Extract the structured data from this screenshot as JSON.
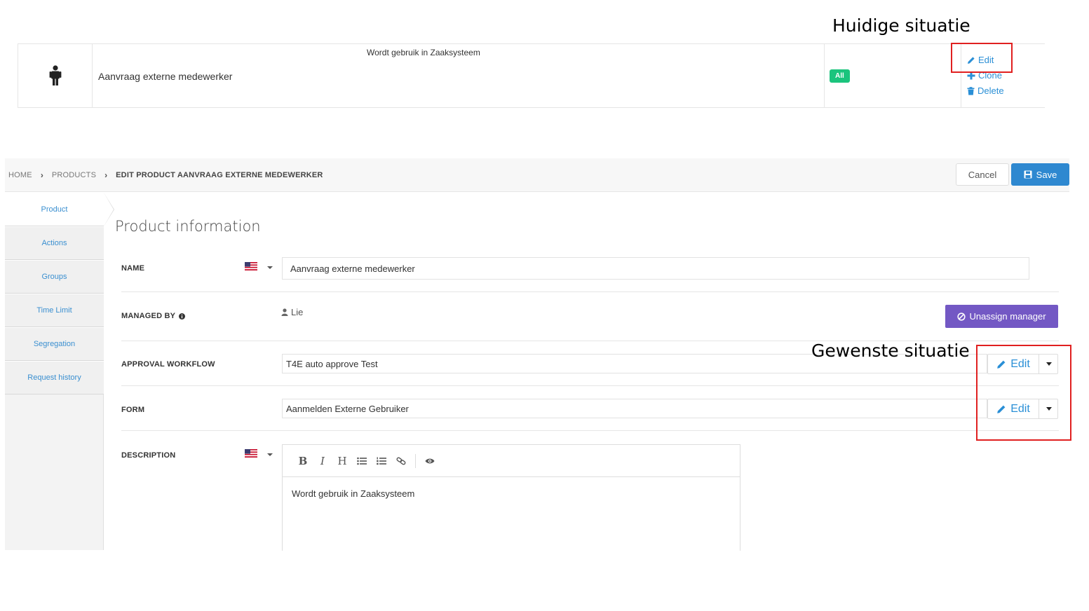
{
  "annotations": {
    "current": "Huidige situatie",
    "desired": "Gewenste situatie"
  },
  "list_row": {
    "description": "Wordt gebruik in Zaaksysteem",
    "name": "Aanvraag externe medewerker",
    "badge": "All",
    "actions": {
      "edit": "Edit",
      "clone": "Clone",
      "delete": "Delete"
    },
    "icon": "person-icon"
  },
  "breadcrumb": {
    "home": "HOME",
    "products": "PRODUCTS",
    "current": "EDIT PRODUCT AANVRAAG EXTERNE MEDEWERKER"
  },
  "toolbar": {
    "cancel_label": "Cancel",
    "save_label": "Save"
  },
  "sidebar": {
    "items": [
      {
        "label": "Product",
        "active": true
      },
      {
        "label": "Actions"
      },
      {
        "label": "Groups"
      },
      {
        "label": "Time Limit"
      },
      {
        "label": "Segregation"
      },
      {
        "label": "Request history"
      }
    ]
  },
  "form": {
    "title": "Product information",
    "name": {
      "label": "NAME",
      "value": "Aanvraag externe medewerker",
      "language": "en-US"
    },
    "managed_by": {
      "label": "MANAGED BY",
      "value": "Lie",
      "unassign_label": "Unassign manager"
    },
    "approval_workflow": {
      "label": "APPROVAL WORKFLOW",
      "value": "T4E auto approve Test",
      "edit_label": "Edit"
    },
    "form_field": {
      "label": "FORM",
      "value": "Aanmelden Externe Gebruiker",
      "edit_label": "Edit"
    },
    "description": {
      "label": "DESCRIPTION",
      "value": "Wordt gebruik in Zaaksysteem",
      "toolbar": [
        "B",
        "I",
        "H"
      ]
    }
  },
  "colors": {
    "accent": "#2e88d0",
    "badge": "#1bc47d",
    "unassign": "#7358c4",
    "annotation_box": "#e02020",
    "link": "#2a8fd6"
  }
}
